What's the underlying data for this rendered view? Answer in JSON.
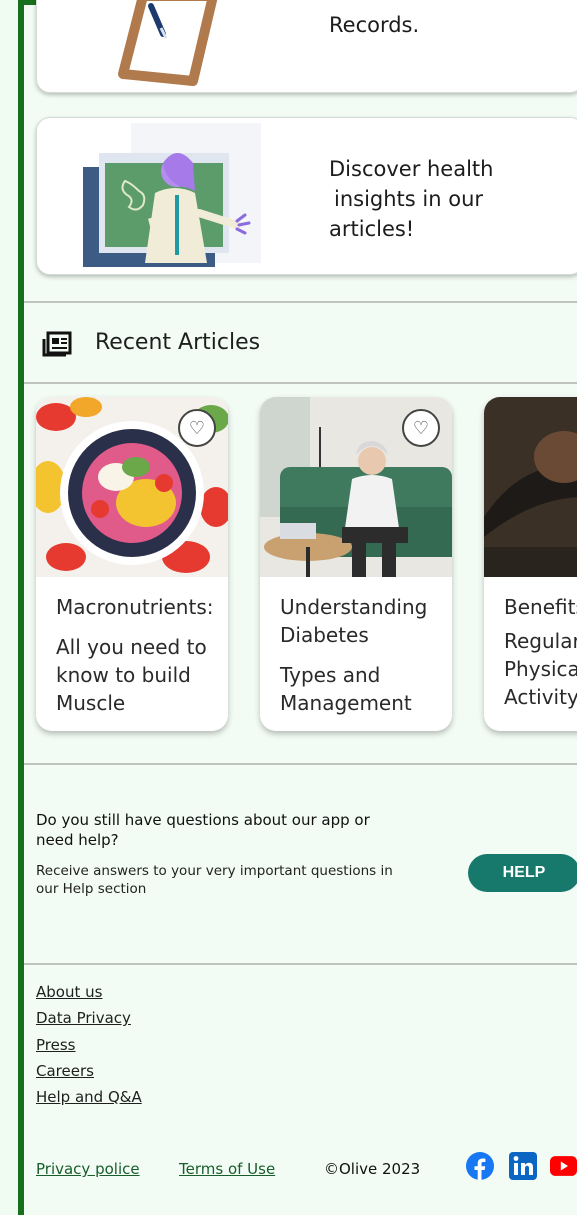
{
  "cards": [
    {
      "text": "Records."
    },
    {
      "text_lines": [
        "Discover health",
        "insights in our",
        "articles!"
      ]
    }
  ],
  "recent_articles": {
    "title": "Recent Articles",
    "icon": "newspaper-icon",
    "items": [
      {
        "title": "Macronutrients:",
        "subtitle": "All you need to know to build Muscle"
      },
      {
        "title": "Understanding Diabetes",
        "subtitle": "Types and Management"
      },
      {
        "title": "Benefits",
        "subtitle": "Regular Physical Activity"
      }
    ]
  },
  "help": {
    "question": "Do you still have questions about our app or need help?",
    "description": "Receive answers to your very important questions in our Help section",
    "button": "HELP"
  },
  "footer": {
    "links": [
      "About us",
      "Data Privacy",
      "Press",
      "Careers",
      "Help and Q&A"
    ],
    "privacy": "Privacy police",
    "terms": "Terms of Use",
    "copyright": "©Olive 2023",
    "social": [
      "facebook-icon",
      "linkedin-icon",
      "youtube-icon"
    ]
  },
  "colors": {
    "accent": "#17701b",
    "button": "#17786c",
    "background": "#f2fcf4"
  }
}
